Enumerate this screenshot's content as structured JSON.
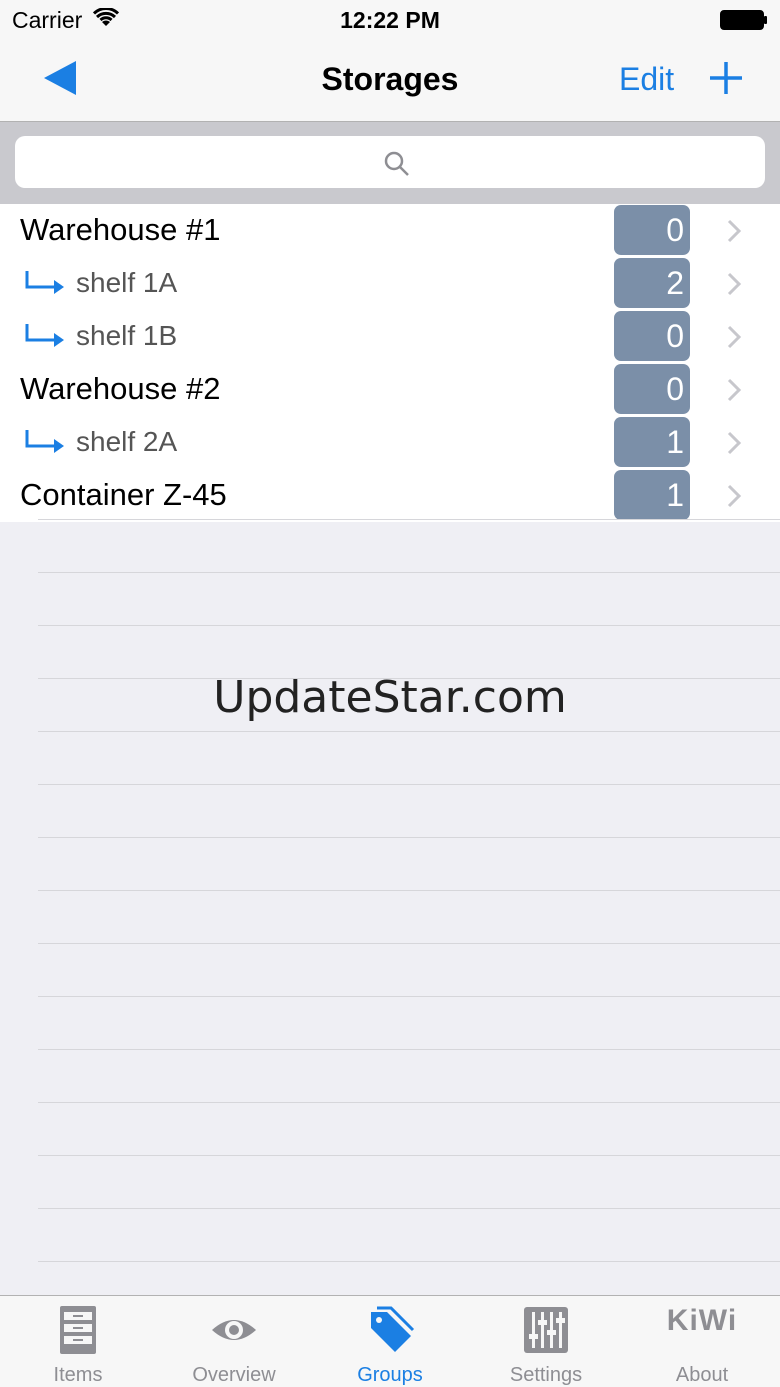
{
  "status_bar": {
    "carrier": "Carrier",
    "time": "12:22 PM"
  },
  "nav": {
    "title": "Storages",
    "edit_label": "Edit"
  },
  "search": {
    "placeholder": ""
  },
  "rows": [
    {
      "title": "Warehouse #1",
      "count": "0",
      "child": false
    },
    {
      "title": "shelf 1A",
      "count": "2",
      "child": true
    },
    {
      "title": "shelf 1B",
      "count": "0",
      "child": true
    },
    {
      "title": "Warehouse #2",
      "count": "0",
      "child": false
    },
    {
      "title": "shelf 2A",
      "count": "1",
      "child": true
    },
    {
      "title": "Container Z-45",
      "count": "1",
      "child": false
    }
  ],
  "watermark": "UpdateStar.com",
  "tabs": [
    {
      "label": "Items",
      "icon": "cabinet-icon"
    },
    {
      "label": "Overview",
      "icon": "eye-icon"
    },
    {
      "label": "Groups",
      "icon": "tag-icon",
      "active": true
    },
    {
      "label": "Settings",
      "icon": "sliders-icon"
    },
    {
      "label": "About",
      "icon": "kiwi-logo",
      "logo_text": "KiWi"
    }
  ],
  "colors": {
    "accent": "#1b7fe3",
    "badge": "#7b8fa8",
    "inactive": "#8e8e93"
  }
}
